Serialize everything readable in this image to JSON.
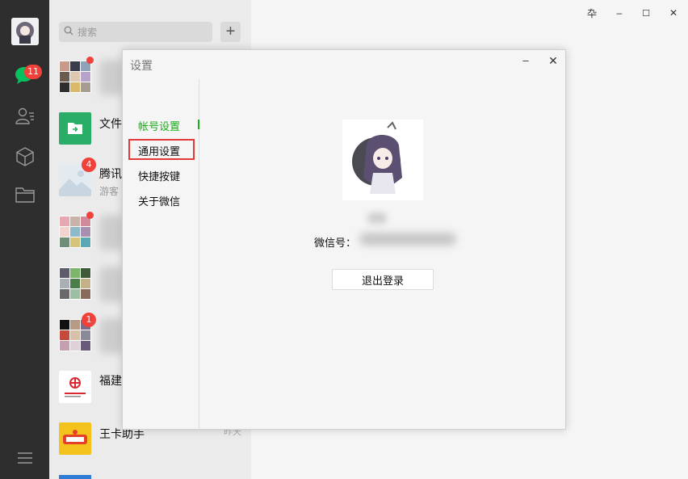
{
  "search": {
    "placeholder": "搜索"
  },
  "nav": {
    "chat_badge": "11"
  },
  "chats": [
    {
      "name": "",
      "sub": "",
      "badge": ""
    },
    {
      "name": "文件",
      "sub": "",
      "badge": ""
    },
    {
      "name": "腾讯",
      "sub": "游客",
      "badge": "4"
    },
    {
      "name": "",
      "sub": "",
      "badge": ""
    },
    {
      "name": "",
      "sub": "",
      "badge": ""
    },
    {
      "name": "",
      "sub": "",
      "badge": "1"
    },
    {
      "name": "福建",
      "sub": "",
      "badge": ""
    },
    {
      "name": "王卡助手",
      "sub": "",
      "time": "昨天"
    }
  ],
  "window": {
    "pin": "卆",
    "min": "–",
    "max": "☐",
    "close": "✕"
  },
  "dialog": {
    "title": "设置",
    "min": "–",
    "close": "✕",
    "menu": [
      "帐号设置",
      "通用设置",
      "快捷按键",
      "关于微信"
    ],
    "wxid_label": "微信号：",
    "logout_label": "退出登录"
  },
  "colors": {
    "accent": "#1aad19",
    "badge": "#f0413b",
    "highlight": "#e23a3a"
  }
}
